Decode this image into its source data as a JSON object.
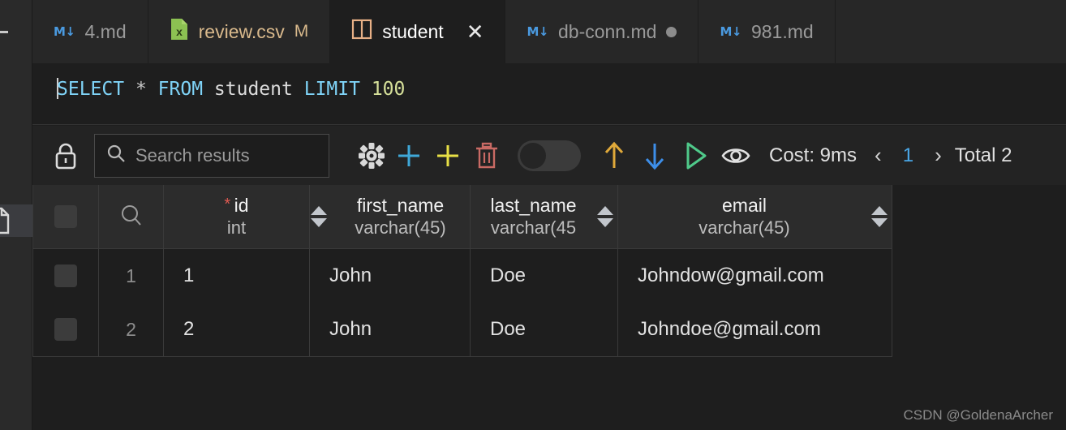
{
  "window": {
    "background": "#1e1e1e",
    "accent": "#4aa8e8"
  },
  "rail": {
    "item_icon": "file-document-icon"
  },
  "tabs": [
    {
      "label": "4.md",
      "icon": "markdown-icon",
      "active": false,
      "modified_flag": "",
      "dirty": false
    },
    {
      "label": "review.csv",
      "icon": "csv-file-icon",
      "active": false,
      "modified_flag": "M",
      "dirty": false
    },
    {
      "label": "student",
      "icon": "table-columns-icon",
      "active": true,
      "modified_flag": "",
      "dirty": false,
      "closable": true,
      "close_label": "✕"
    },
    {
      "label": "db-conn.md",
      "icon": "markdown-icon",
      "active": false,
      "modified_flag": "",
      "dirty": true
    },
    {
      "label": "981.md",
      "icon": "markdown-icon",
      "active": false,
      "modified_flag": "",
      "dirty": false
    }
  ],
  "editor": {
    "sql": {
      "full_text": "SELECT * FROM student LIMIT 100",
      "tokens": [
        {
          "text": "SELECT",
          "kind": "keyword"
        },
        {
          "text": " ",
          "kind": "plain"
        },
        {
          "text": "*",
          "kind": "operator"
        },
        {
          "text": " ",
          "kind": "plain"
        },
        {
          "text": "FROM",
          "kind": "keyword"
        },
        {
          "text": " ",
          "kind": "plain"
        },
        {
          "text": "student",
          "kind": "identifier"
        },
        {
          "text": " ",
          "kind": "plain"
        },
        {
          "text": "LIMIT",
          "kind": "keyword"
        },
        {
          "text": " ",
          "kind": "plain"
        },
        {
          "text": "100",
          "kind": "number"
        }
      ]
    }
  },
  "toolbar": {
    "lock_icon": "lock-closed-icon",
    "search": {
      "icon": "search-icon",
      "value": "",
      "placeholder": "Search results"
    },
    "settings_icon": "gear-icon",
    "add_row_icon": "plus-icon",
    "add_column_icon": "plus-icon",
    "delete_icon": "trash-icon",
    "toggle": {
      "name": "edit-mode-toggle",
      "state": "off"
    },
    "commit_icon": "arrow-up-icon",
    "refresh_icon": "arrow-down-icon",
    "run_icon": "play-icon",
    "preview_icon": "eye-icon",
    "cost_label": "Cost: 9ms",
    "prev_page": "‹",
    "page_number": "1",
    "next_page": "›",
    "total_label": "Total 2"
  },
  "grid": {
    "select_all_checkbox": "",
    "search_column_icon": "search-icon",
    "columns": [
      {
        "name": "id",
        "type": "int",
        "primary_key": true,
        "pk_marker": "*",
        "sortable": false
      },
      {
        "name": "first_name",
        "type": "varchar(45)",
        "primary_key": false,
        "sortable": true
      },
      {
        "name": "last_name",
        "type": "varchar(45",
        "primary_key": false,
        "sortable": true
      },
      {
        "name": "email",
        "type": "varchar(45)",
        "primary_key": false,
        "sortable": true
      }
    ],
    "rows": [
      {
        "num": "1",
        "id": "1",
        "first_name": "John",
        "last_name": "Doe",
        "email": "Johndow@gmail.com"
      },
      {
        "num": "2",
        "id": "2",
        "first_name": "John",
        "last_name": "Doe",
        "email": "Johndoe@gmail.com"
      }
    ]
  },
  "watermark": {
    "text": "CSDN @GoldenaArcher"
  }
}
